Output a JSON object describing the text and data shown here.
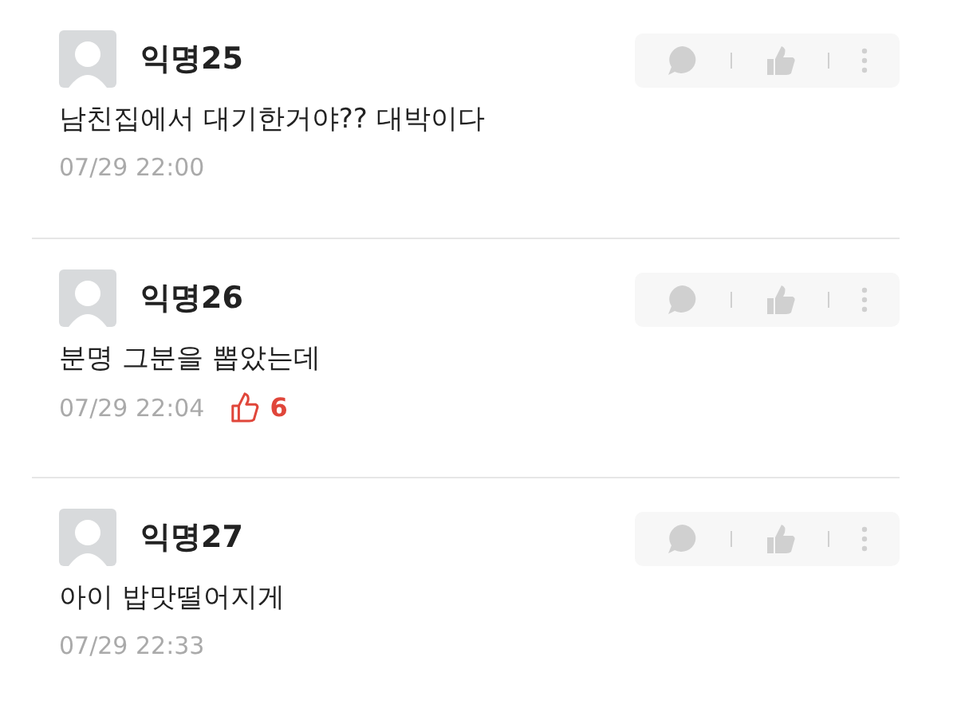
{
  "comments": [
    {
      "author": "익명25",
      "text": "남친집에서 대기한거야?? 대박이다",
      "time": "07/29 22:00"
    },
    {
      "author": "익명26",
      "text": "분명 그분을 뽑았는데",
      "time": "07/29 22:04",
      "likes": "6"
    },
    {
      "author": "익명27",
      "text": "아이 밥맛떨어지게",
      "time": "07/29 22:33"
    }
  ]
}
